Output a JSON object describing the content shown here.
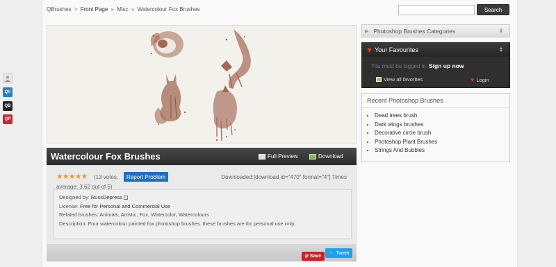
{
  "breadcrumb": {
    "site": "QBrushes",
    "sep1": ">",
    "front": "Front Page",
    "sep2": "»",
    "misc": "Misc",
    "sep3": "»",
    "current": "Watercolour Fox Brushes"
  },
  "search": {
    "button": "Search",
    "value": ""
  },
  "social": {
    "qv": "QV",
    "qb": "QB",
    "qp": "QP"
  },
  "main": {
    "title": "Watercolour Fox Brushes",
    "full_preview": "Full Preview",
    "download": "Download"
  },
  "rating": {
    "stars": "★★★★★",
    "votes": "(13 votes,",
    "average": "average: 3.62 out of 5)",
    "report": "Report Problem",
    "downloaded": "Downloaded:[download id=\"470\" format=\"4\"] Times"
  },
  "details": {
    "designed_label": "Designed by:",
    "designer": "RussDepress",
    "license_label": "License:",
    "license": "Free for Personal and Commercial Use",
    "related_label": "Related brushes:",
    "related": "Animals, Artistic, Fox, Watercolor, Watercolours",
    "desc_label": "Description:",
    "description": "Four watercolour painted fox photoshop brushes. these brushes are for personal use only."
  },
  "share": {
    "save": "Save",
    "tweet": "Tweet"
  },
  "sidebar": {
    "categories": "Photoshop Brushes Categories",
    "favourites": "Your Favourites",
    "fav_msg": "You must be logged in.",
    "signup": "Sign up now",
    "view_all": "View all favorites",
    "login": "Login",
    "recent_title": "Recent Photoshop Brushes",
    "recent": [
      "Dead trees brush",
      "Dark wings brushes",
      "Decorative circle brush",
      "Photoshop Plant Brushes",
      "Strings And Bubbles"
    ]
  },
  "colors": {
    "accent_red": "#c8232c",
    "twitter": "#1da1f2",
    "report_blue": "#1f6fbf",
    "ink": "#8a3b22"
  }
}
